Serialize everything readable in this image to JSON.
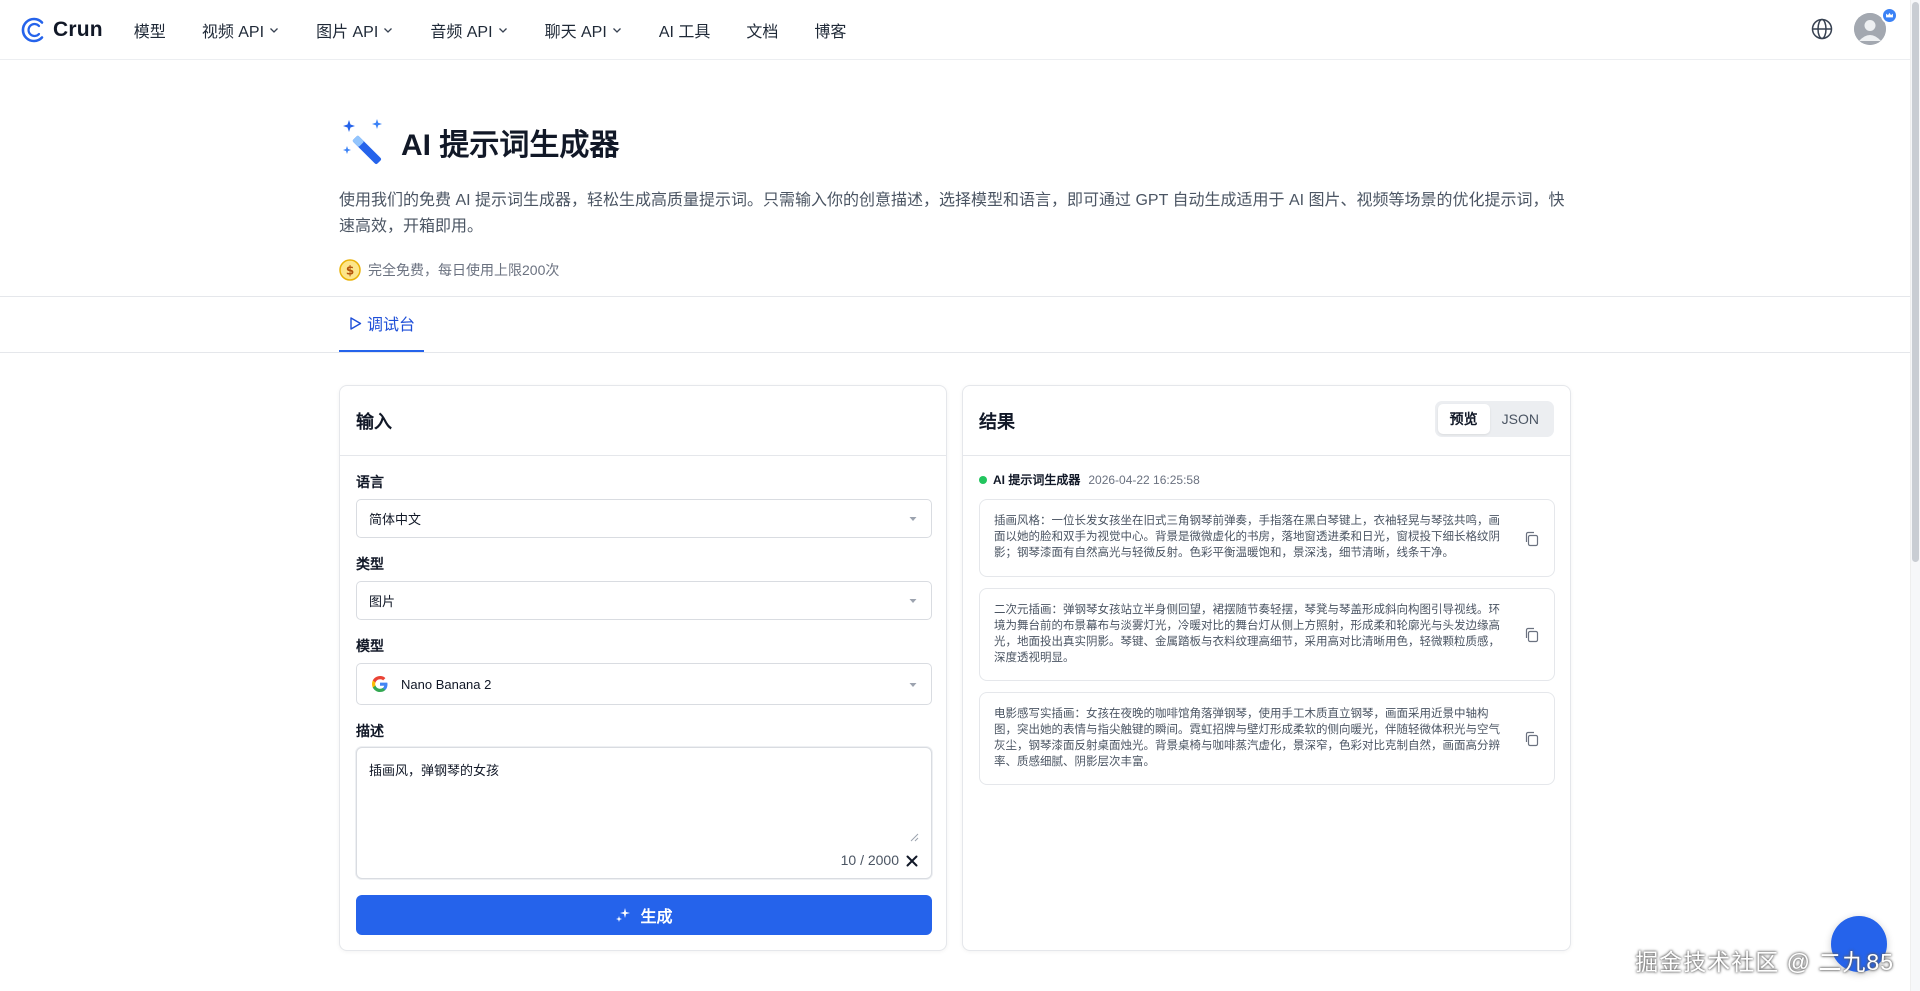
{
  "brand": {
    "name": "Crun"
  },
  "nav": {
    "items": [
      {
        "label": "模型",
        "dropdown": false
      },
      {
        "label": "视频 API",
        "dropdown": true
      },
      {
        "label": "图片 API",
        "dropdown": true
      },
      {
        "label": "音频 API",
        "dropdown": true
      },
      {
        "label": "聊天 API",
        "dropdown": true
      },
      {
        "label": "AI 工具",
        "dropdown": false
      },
      {
        "label": "文档",
        "dropdown": false
      },
      {
        "label": "博客",
        "dropdown": false
      }
    ]
  },
  "hero": {
    "title": "AI 提示词生成器",
    "description": "使用我们的免费 AI 提示词生成器，轻松生成高质量提示词。只需输入你的创意描述，选择模型和语言，即可通过 GPT 自动生成适用于 AI 图片、视频等场景的优化提示词，快速高效，开箱即用。",
    "free_note": "完全免费，每日使用上限200次"
  },
  "tabs": [
    {
      "label": "调试台",
      "active": true
    }
  ],
  "input_panel": {
    "title": "输入",
    "language_label": "语言",
    "language_value": "简体中文",
    "type_label": "类型",
    "type_value": "图片",
    "model_label": "模型",
    "model_value": "Nano Banana 2",
    "desc_label": "描述",
    "desc_value": "插画风，弹钢琴的女孩",
    "char_count": "10 / 2000",
    "generate_label": "生成"
  },
  "result_panel": {
    "title": "结果",
    "view_preview": "预览",
    "view_json": "JSON",
    "source": "AI 提示词生成器",
    "timestamp": "2026-04-22 16:25:58",
    "results": [
      "插画风格：一位长发女孩坐在旧式三角钢琴前弹奏，手指落在黑白琴键上，衣袖轻晃与琴弦共鸣，画面以她的脸和双手为视觉中心。背景是微微虚化的书房，落地窗透进柔和日光，窗棂投下细长格纹阴影；钢琴漆面有自然高光与轻微反射。色彩平衡温暖饱和，景深浅，细节清晰，线条干净。",
      "二次元插画：弹钢琴女孩站立半身侧回望，裙摆随节奏轻摆，琴凳与琴盖形成斜向构图引导视线。环境为舞台前的布景幕布与淡雾灯光，冷暖对比的舞台灯从侧上方照射，形成柔和轮廓光与头发边缘高光，地面投出真实阴影。琴键、金属踏板与衣料纹理高细节，采用高对比清晰用色，轻微颗粒质感，深度透视明显。",
      "电影感写实插画：女孩在夜晚的咖啡馆角落弹钢琴，使用手工木质直立钢琴，画面采用近景中轴构图，突出她的表情与指尖触键的瞬间。霓虹招牌与壁灯形成柔软的侧向暖光，伴随轻微体积光与空气灰尘，钢琴漆面反射桌面烛光。背景桌椅与咖啡蒸汽虚化，景深窄，色彩对比克制自然，画面高分辨率、质感细腻、阴影层次丰富。"
    ]
  },
  "watermark": "掘金技术社区 @ 二九85",
  "colors": {
    "accent": "#2563eb",
    "tab_text": "#1d4ed8",
    "status_dot": "#22c55e"
  }
}
